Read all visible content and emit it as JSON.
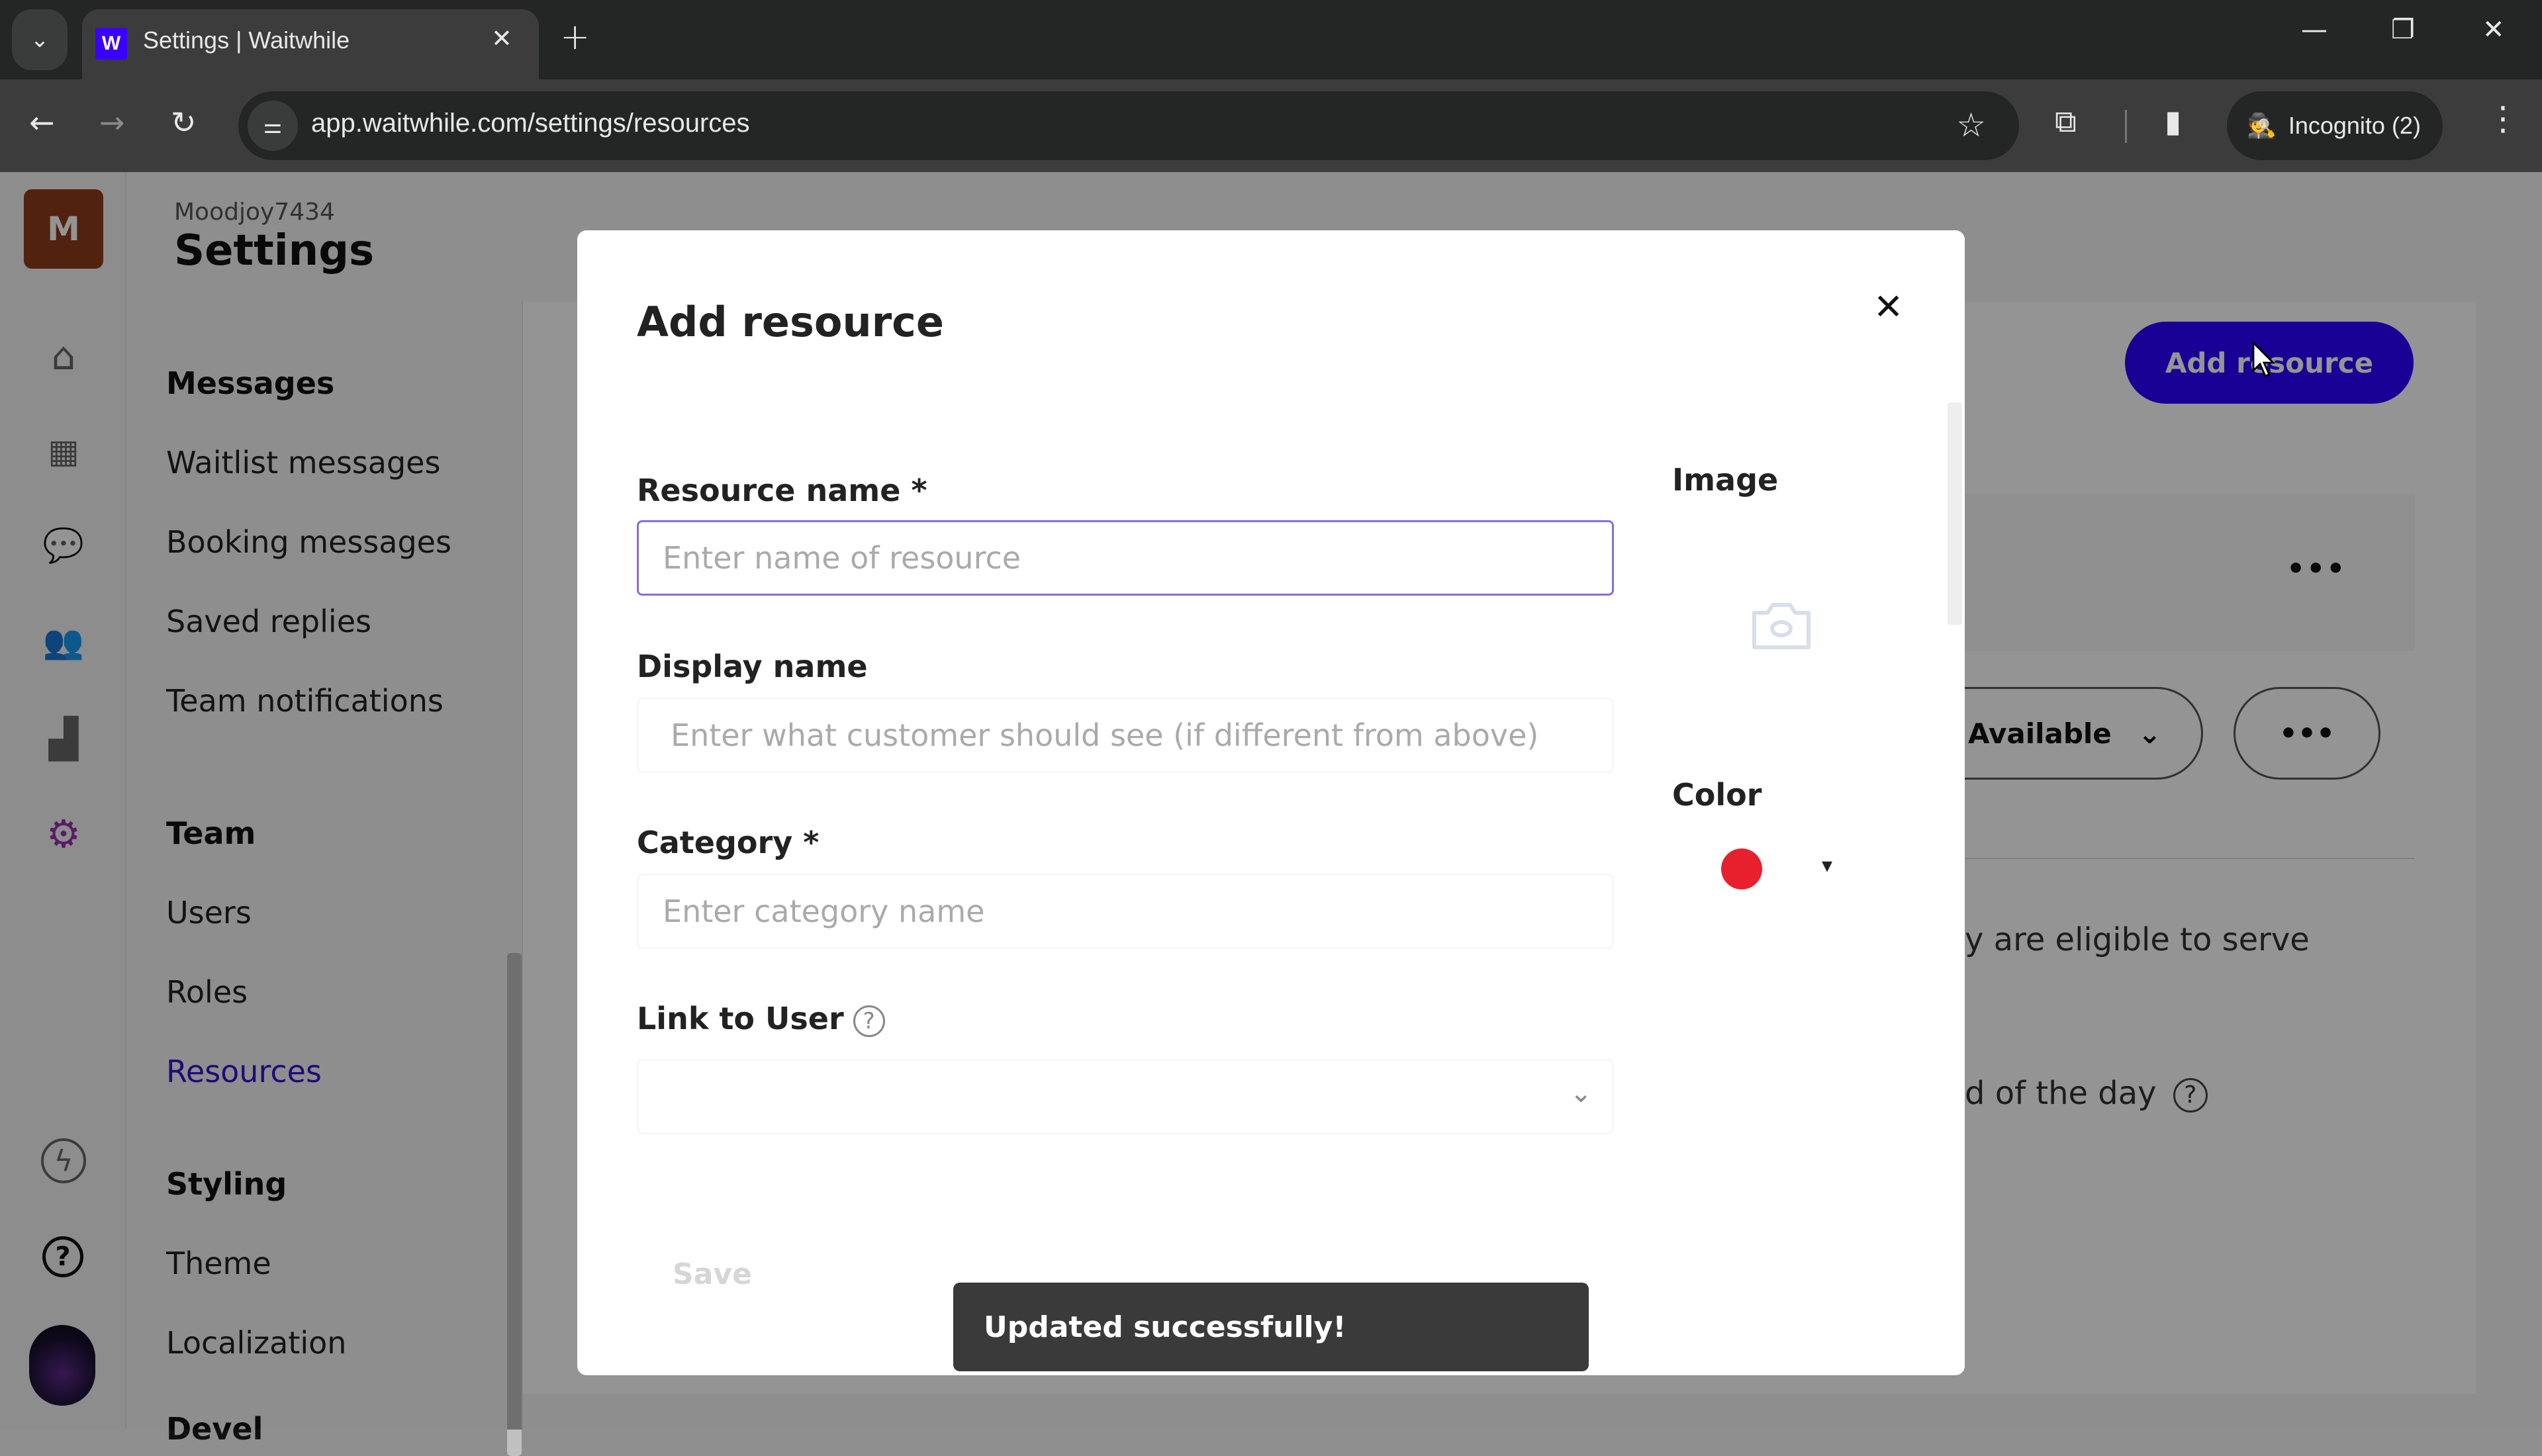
{
  "browser": {
    "tab_title": "Settings | Waitwhile",
    "favicon_letter": "W",
    "url": "app.waitwhile.com/settings/resources",
    "incognito_label": "Incognito (2)",
    "icons": {
      "tab_list": "chevron-down-icon",
      "tab_close": "close-icon",
      "new_tab": "plus-icon",
      "minimize": "minimize-icon",
      "restore": "restore-icon",
      "window_close": "close-icon",
      "back": "arrow-left-icon",
      "forward": "arrow-right-icon",
      "reload": "reload-icon",
      "site_info": "tune-icon",
      "bookmark": "star-icon",
      "extensions": "puzzle-icon",
      "side_panel": "side-panel-icon",
      "incognito": "incognito-icon",
      "menu": "more-vert-icon"
    },
    "glyphs": {
      "tab_list": "⌄",
      "tab_close": "✕",
      "new_tab": "+",
      "minimize": "—",
      "restore": "❐",
      "window_close": "✕",
      "back": "←",
      "forward": "→",
      "reload": "↻",
      "site_info": "⚌",
      "bookmark": "☆",
      "extensions": "⧉",
      "side_panel": "▮",
      "incognito": "🕵",
      "menu": "⋮"
    }
  },
  "app": {
    "org_initial": "M",
    "org_name": "Moodjoy7434",
    "page_title": "Settings",
    "rail": [
      {
        "name": "home-icon",
        "glyph": "⌂"
      },
      {
        "name": "calendar-icon",
        "glyph": "▦"
      },
      {
        "name": "chat-icon",
        "glyph": "💬"
      },
      {
        "name": "users-icon",
        "glyph": "👥"
      },
      {
        "name": "analytics-icon",
        "glyph": "▟"
      },
      {
        "name": "settings-gear-icon",
        "glyph": "⚙",
        "active": true
      },
      {
        "name": "bolt-icon",
        "glyph": "ϟ"
      },
      {
        "name": "help-icon",
        "glyph": "?"
      }
    ],
    "settings_nav": {
      "sections": [
        {
          "heading": "Messages",
          "items": [
            "Waitlist messages",
            "Booking messages",
            "Saved replies",
            "Team notifications"
          ]
        },
        {
          "heading": "Team",
          "items": [
            "Users",
            "Roles",
            "Resources"
          ]
        },
        {
          "heading": "Styling",
          "items": [
            "Theme",
            "Localization"
          ]
        },
        {
          "heading": "Devel",
          "items": []
        }
      ],
      "active_item": "Resources"
    },
    "content": {
      "add_resource_label": "Add resource",
      "card_more": "•••",
      "status_value": "Available",
      "status_chevron": "⌄",
      "status_more": "•••",
      "text_line_1": "y are eligible to serve",
      "text_line_2": "d of the day",
      "help_glyph": "?"
    },
    "accent_color": "#2b00ff",
    "active_nav_color": "#3a10d0"
  },
  "modal": {
    "title": "Add resource",
    "close_glyph": "✕",
    "fields": {
      "resource_name": {
        "label": "Resource name *",
        "placeholder": "Enter name of resource",
        "value": ""
      },
      "display_name": {
        "label": "Display name",
        "placeholder": "Enter what customer should see (if different from above)",
        "value": ""
      },
      "category": {
        "label": "Category *",
        "placeholder": "Enter category name",
        "value": ""
      },
      "link_to_user": {
        "label": "Link to User",
        "help_glyph": "?",
        "value": "",
        "chevron": "⌄"
      }
    },
    "image_label": "Image",
    "color_label": "Color",
    "selected_color": "#e8202e",
    "color_caret": "▾",
    "save_label": "Save"
  },
  "toast": {
    "message": "Updated successfully!"
  }
}
